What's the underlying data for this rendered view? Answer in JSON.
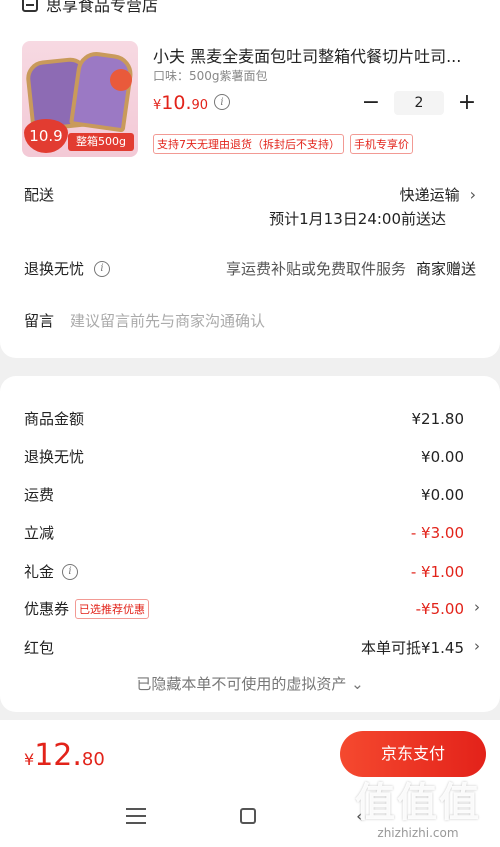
{
  "store": {
    "name": "思享食品专营店",
    "icon": "store-icon"
  },
  "product": {
    "title": "小夫 黑麦全麦面包吐司整箱代餐切片吐司...",
    "spec": "口味：500g紫薯面包",
    "price": {
      "yen": "¥",
      "int": "10.",
      "dec": "90"
    },
    "quantity": "2",
    "decrement": "−",
    "increment": "+",
    "tags": [
      "支持7天无理由退货（拆封后不支持）",
      "手机专享价"
    ],
    "image": {
      "price_tag": "10.9",
      "badge": "整箱500g"
    }
  },
  "delivery": {
    "label": "配送",
    "method": "快递运输",
    "eta": "预计1月13日24:00前送达"
  },
  "return_service": {
    "label": "退换无忧",
    "desc": "享运费补贴或免费取件服务",
    "provider": "商家赠送"
  },
  "note": {
    "label": "留言",
    "placeholder": "建议留言前先与商家沟通确认"
  },
  "fees": [
    {
      "label": "商品金额",
      "value": "¥21.80",
      "red": false
    },
    {
      "label": "退换无忧",
      "value": "¥0.00",
      "red": false
    },
    {
      "label": "运费",
      "value": "¥0.00",
      "red": false
    },
    {
      "label": "立减",
      "value": "- ¥3.00",
      "red": true
    },
    {
      "label": "礼金",
      "value": "- ¥1.00",
      "red": true
    },
    {
      "label": "优惠券",
      "value": "-¥5.00",
      "red": true,
      "tag": "已选推荐优惠"
    },
    {
      "label": "红包",
      "value": "本单可抵¥1.45",
      "red": false
    }
  ],
  "hidden_assets": "已隐藏本单不可使用的虚拟资产 ⌄",
  "total": {
    "yen": "¥",
    "int": "12.",
    "dec": "80"
  },
  "pay_button": "京东支付",
  "watermark": {
    "logo": "值值值",
    "url": "zhizhizhi.com"
  },
  "colors": {
    "accent": "#e2231a",
    "background": "#f0f0f0"
  }
}
